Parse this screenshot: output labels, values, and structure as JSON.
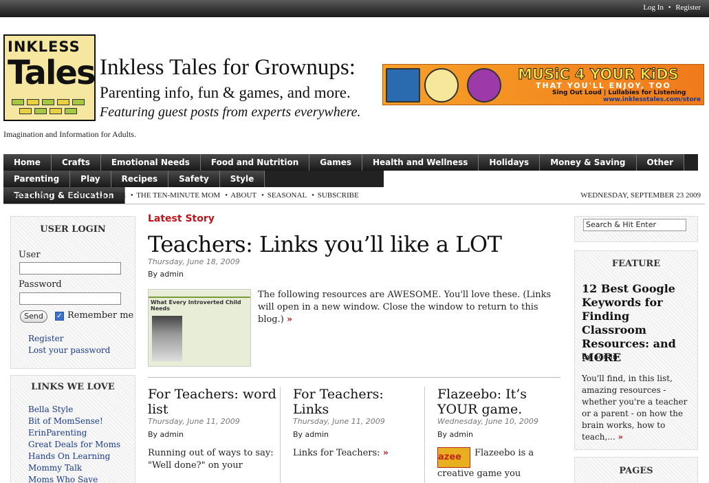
{
  "topbar": {
    "login": "Log In",
    "sep": "•",
    "register": "Register"
  },
  "logo": {
    "small": "INKLESS",
    "big": "Tales"
  },
  "site": {
    "title": "Inkless Tales for Grownups:",
    "subtitle": "Parenting info, fun & games, and more.",
    "subtitle2": "Featuring guest posts from experts everywhere.",
    "tagline": "Imagination and Information for Adults."
  },
  "banner": {
    "headline": "MUSiC 4 YOUR KiDS",
    "line2": "THAT YOU'LL ENJOY, TOO",
    "line3": "Sing Out Loud | Lullabies for Listening",
    "url": "www.inklesstales.com/store"
  },
  "nav": {
    "row1": [
      "Home",
      "Crafts",
      "Emotional Needs",
      "Food and Nutrition",
      "Games",
      "Health and Wellness",
      "Holidays",
      "Money & Saving",
      "Other"
    ],
    "row2": [
      "Parenting",
      "Play",
      "Recipes",
      "Safety",
      "Style",
      "Teaching & Education"
    ]
  },
  "subnav": {
    "items": [
      "CONTRIBUTE",
      "E-NEWSLETTER",
      "THE TEN-MINUTE MOM",
      "ABOUT",
      "SEASONAL",
      "SUBSCRIBE"
    ],
    "sep": "•",
    "date": "WEDNESDAY, SEPTEMBER 23 2009"
  },
  "login": {
    "heading": "USER LOGIN",
    "user_label": "User",
    "password_label": "Password",
    "send": "Send",
    "remember": "Remember me",
    "register": "Register",
    "lost": "Lost your password"
  },
  "links": {
    "heading": "LINKS WE LOVE",
    "items": [
      "Bella Style",
      "Bit of MomSense!",
      "ErinParenting",
      "Great Deals for Moms",
      "Hands On Learning",
      "Mommy Talk",
      "Moms Who Save"
    ]
  },
  "main": {
    "latest_label": "Latest Story",
    "headline": "Teachers: Links you’ll like a LOT",
    "date": "Thursday, June 18, 2009",
    "byline": "By admin",
    "thumb_title": "What Every Introverted Child Needs",
    "excerpt": "The following resources are AWESOME. You'll love these. (Links will open in a new window. Close the window to return to this blog.)",
    "raquo": "»",
    "posts": [
      {
        "title": "For Teachers: word list",
        "date": "Thursday, June 11, 2009",
        "byline": "By admin",
        "text": "Running out of ways to say: \"Well done?\" on your"
      },
      {
        "title": "For Teachers: Links",
        "date": "Thursday, June 11, 2009",
        "byline": "By admin",
        "text": "Links for Teachers:"
      },
      {
        "title": "Flazeebo: It’s YOUR game.",
        "date": "Wednesday, June 10, 2009",
        "byline": "By admin",
        "text": "Flazeebo is a creative game you"
      }
    ]
  },
  "sidebar": {
    "search_value": "Search & Hit Enter",
    "feature_heading": "FEATURE",
    "feature_title": "12 Best Google Keywords for Finding Classroom Resources: and MORE",
    "feature_byline": "By admin",
    "feature_text": "You'll find, in this list, amazing resources - whether you're a teacher or a parent - on how the brain works, how to teach,...",
    "pages_heading": "PAGES"
  },
  "colors": {
    "accent_red": "#c0141c",
    "link_blue": "#1a3a8a",
    "nav_bg": "#222222"
  }
}
